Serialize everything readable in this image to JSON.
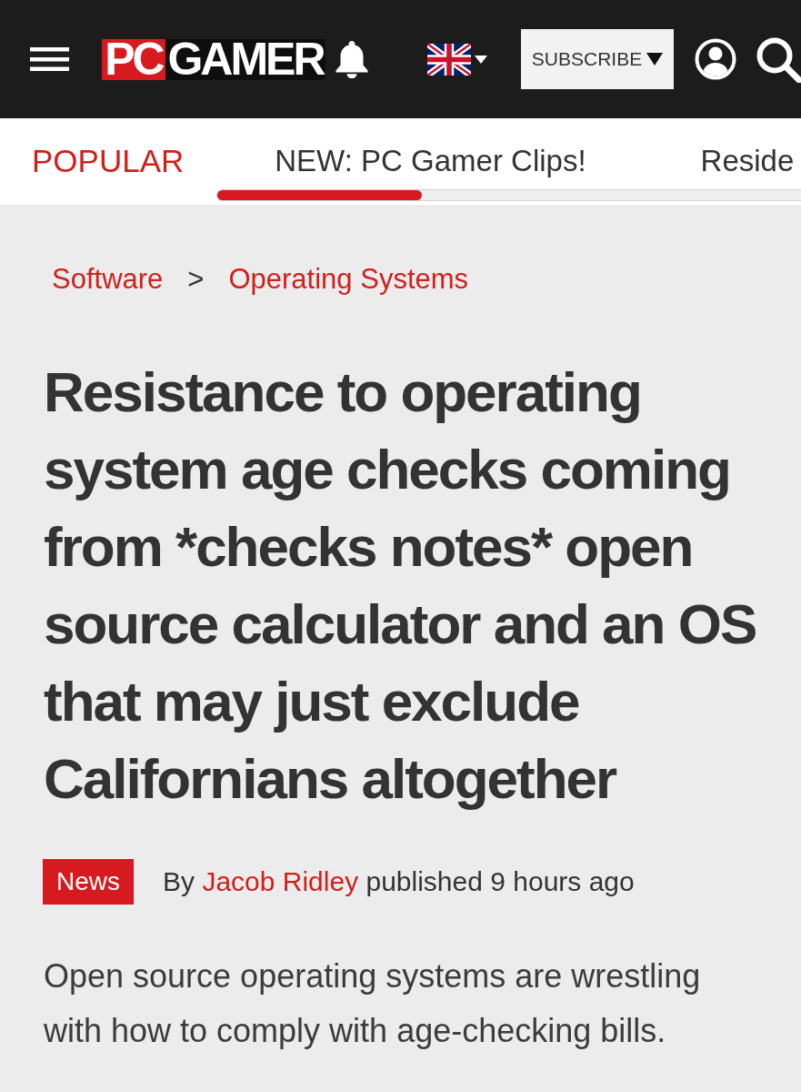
{
  "header": {
    "logo": {
      "mark": "PC",
      "wordmark": "GAMER"
    },
    "subscribe_button": {
      "label": "SUBSCRIBE"
    }
  },
  "nav": {
    "heading": "POPULAR",
    "items": [
      {
        "label": "NEW: PC Gamer Clips!"
      },
      {
        "label": "Reside"
      }
    ]
  },
  "breadcrumb": {
    "items": [
      {
        "label": "Software"
      },
      {
        "label": "Operating Systems"
      }
    ],
    "separator": ">"
  },
  "article": {
    "headline": "Resistance to operating system age checks coming from *checks notes* open source calculator and an OS that may just exclude Californians altogether",
    "tag": "News",
    "byline": {
      "prefix": "By",
      "author": "Jacob Ridley",
      "suffix": "published 9 hours ago"
    },
    "standfirst": "Open source operating systems are wrestling with how to comply with age-checking bills."
  }
}
